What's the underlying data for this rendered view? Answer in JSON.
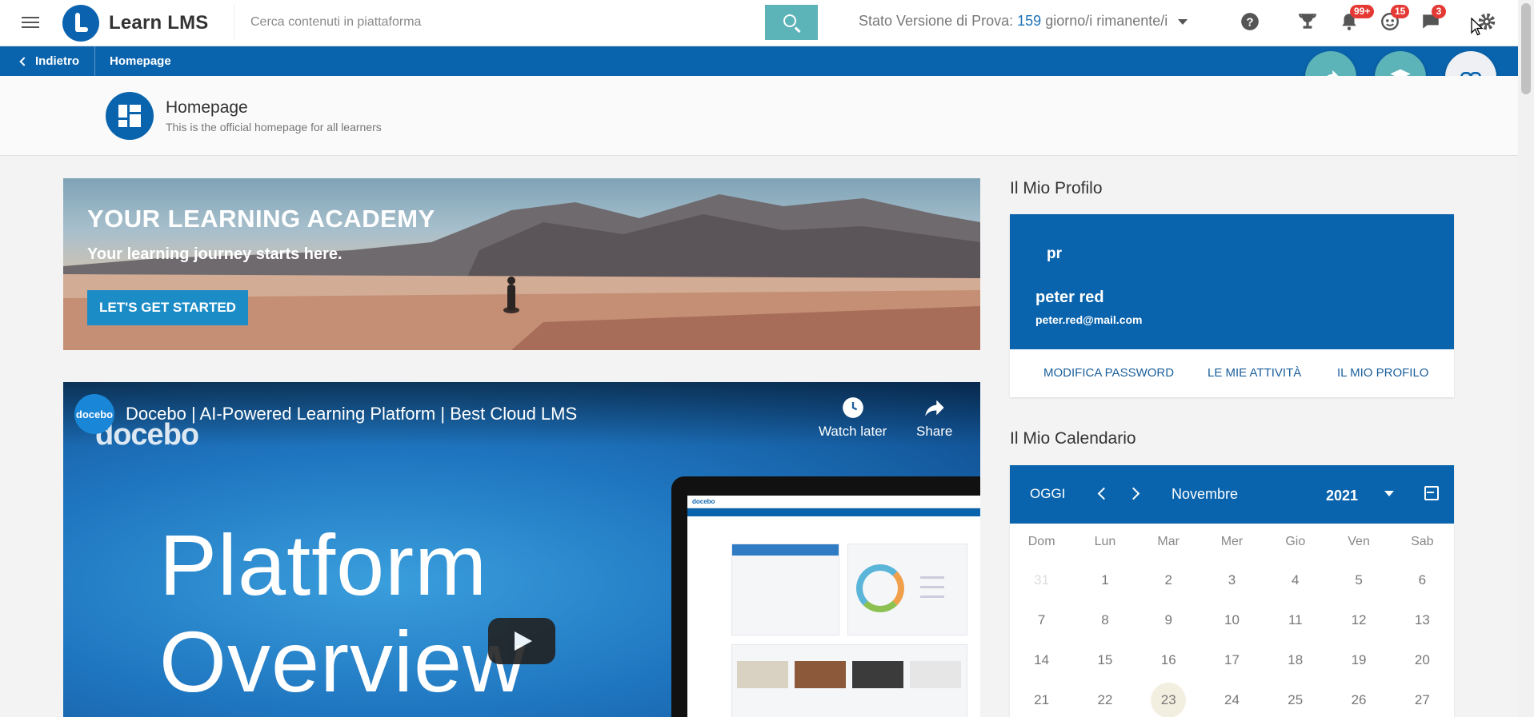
{
  "header": {
    "app_name": "Learn LMS",
    "search_placeholder": "Cerca contenuti in piattaforma",
    "trial": {
      "prefix": "Stato Versione di Prova:",
      "days": "159",
      "suffix": "giorno/i rimanente/i"
    },
    "badges": {
      "notifications": "99+",
      "contacts": "15",
      "messages": "3"
    },
    "icons": [
      "menu-icon",
      "search-icon",
      "help-icon",
      "trophy-icon",
      "bell-icon",
      "contacts-icon",
      "chat-icon",
      "gear-icon"
    ]
  },
  "breadcrumb": {
    "back_label": "Indietro",
    "current": "Homepage"
  },
  "page": {
    "title": "Homepage",
    "subtitle": "This is the official homepage for all learners"
  },
  "banner": {
    "title": "YOUR LEARNING ACADEMY",
    "subtitle": "Your learning journey starts here.",
    "button_label": "LET'S GET STARTED"
  },
  "video": {
    "channel_badge": "docebo",
    "title": "Docebo | AI-Powered Learning Platform | Best Cloud LMS",
    "brand_text": "docebo",
    "watch_later": "Watch later",
    "share": "Share",
    "line1": "Platform",
    "line2": "Overview",
    "screen_brand": "docebo"
  },
  "profile": {
    "heading": "Il Mio Profilo",
    "initials": "pr",
    "name": "peter red",
    "email": "peter.red@mail.com",
    "links": {
      "password": "MODIFICA PASSWORD",
      "activities": "LE MIE ATTIVITÀ",
      "profile": "IL MIO PROFILO"
    }
  },
  "calendar": {
    "heading": "Il Mio Calendario",
    "today_label": "OGGI",
    "month": "Novembre",
    "year": "2021",
    "weekdays": [
      "Dom",
      "Lun",
      "Mar",
      "Mer",
      "Gio",
      "Ven",
      "Sab"
    ],
    "weeks": [
      [
        "31",
        "1",
        "2",
        "3",
        "4",
        "5",
        "6"
      ],
      [
        "7",
        "8",
        "9",
        "10",
        "11",
        "12",
        "13"
      ],
      [
        "14",
        "15",
        "16",
        "17",
        "18",
        "19",
        "20"
      ],
      [
        "21",
        "22",
        "23",
        "24",
        "25",
        "26",
        "27"
      ]
    ],
    "today": "23",
    "muted": [
      "31"
    ]
  },
  "colors": {
    "brand_blue": "#0a64ad",
    "teal": "#5cb3b8",
    "badge_red": "#e53935",
    "link_blue": "#1a5f9c"
  }
}
